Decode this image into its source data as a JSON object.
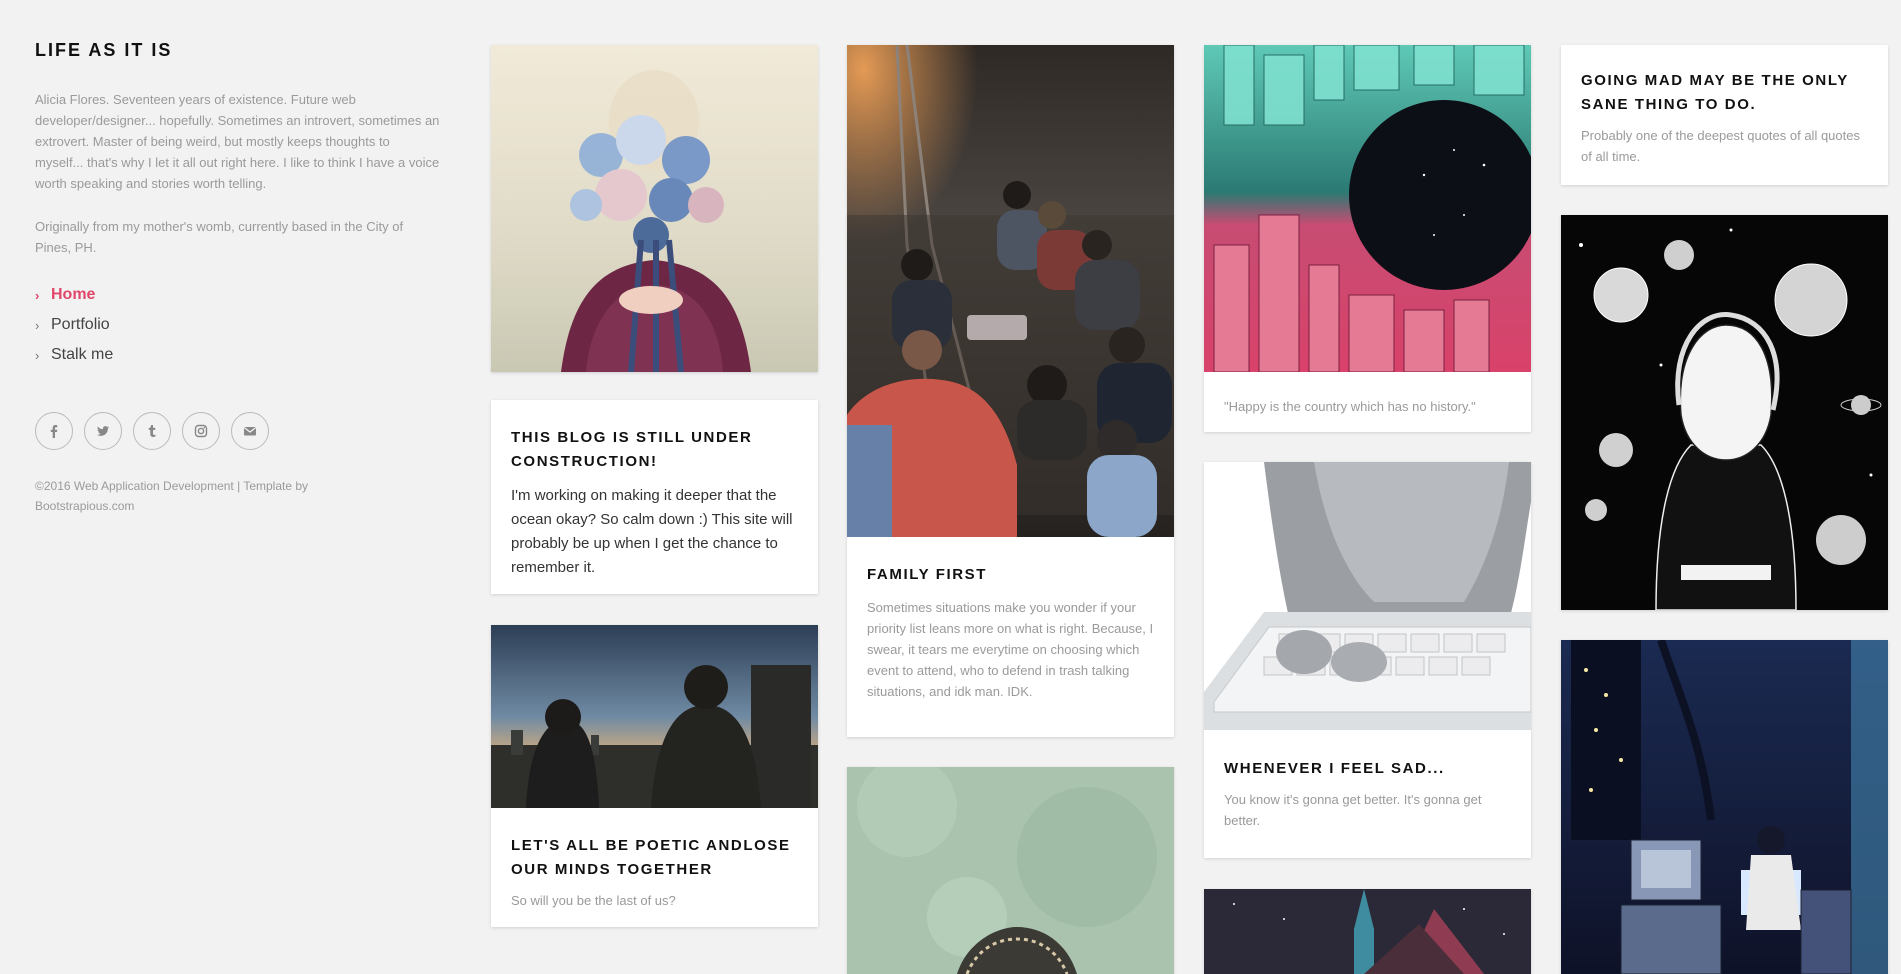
{
  "sidebar": {
    "title": "LIFE AS IT IS",
    "bio_1": "Alicia Flores. Seventeen years of existence. Future web developer/designer... hopefully. Sometimes an introvert, sometimes an extrovert. Master of being weird, but mostly keeps thoughts to myself... that's why I let it all out right here. I like to think I have a voice worth speaking and stories worth telling.",
    "bio_2": "Originally from my mother's womb, currently based in the City of Pines, PH.",
    "nav": [
      {
        "label": "Home",
        "active": true
      },
      {
        "label": "Portfolio",
        "active": false
      },
      {
        "label": "Stalk me",
        "active": false
      }
    ],
    "socials": [
      "facebook-icon",
      "twitter-icon",
      "tumblr-icon",
      "instagram-icon",
      "envelope-icon"
    ],
    "copyright": "©2016 Web Application Development | Template by Bootstrapious.com"
  },
  "posts": {
    "construction": {
      "title": "THIS BLOG IS STILL UNDER CONSTRUCTION!",
      "text": "I'm working on making it deeper that the ocean okay? So calm down :) This site will probably be up when I get the chance to remember it."
    },
    "poetic": {
      "title": "LET'S ALL BE POETIC ANDLOSE OUR MINDS TOGETHER",
      "text": "So will you be the last of us?"
    },
    "family": {
      "title": "FAMILY FIRST",
      "text": "Sometimes situations make you wonder if your priority list leans more on what is right. Because, I swear, it tears me everytime on choosing which event to attend, who to defend in trash talking situations, and idk man. IDK."
    },
    "history": {
      "text": "\"Happy is the country which has no history.\""
    },
    "sad": {
      "title": "WHENEVER I FEEL SAD...",
      "text": "You know it's gonna get better. It's gonna get better."
    },
    "mad": {
      "title": "GOING MAD MAY BE THE ONLY SANE THING TO DO.",
      "text": "Probably one of the deepest quotes of all quotes of all time."
    }
  },
  "colors": {
    "accent": "#e0476a",
    "background": "#f2f2f2"
  }
}
